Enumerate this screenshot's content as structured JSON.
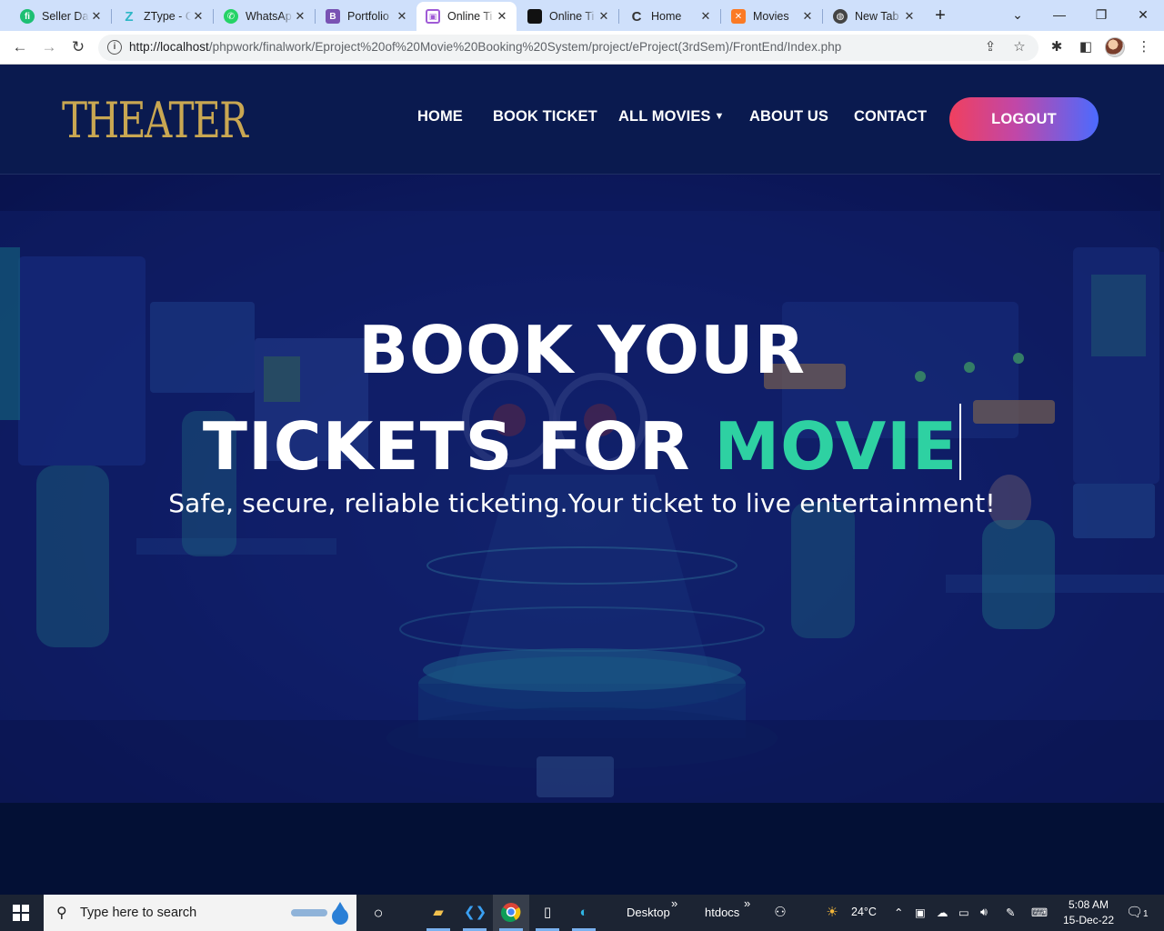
{
  "browser": {
    "tabs": [
      {
        "title": "Seller Da",
        "icon": "fiverr-icon",
        "color": "#1dbf73",
        "glyph": "fi"
      },
      {
        "title": "ZType - C",
        "icon": "ztype-icon",
        "color": "#2db7c6",
        "glyph": "Z"
      },
      {
        "title": "WhatsAp",
        "icon": "whatsapp-icon",
        "color": "#25d366",
        "glyph": "W"
      },
      {
        "title": "Portfolio",
        "icon": "bootstrap-icon",
        "color": "#7952b3",
        "glyph": "B"
      },
      {
        "title": "Online Ti",
        "icon": "site-icon",
        "color": "#a05bd6",
        "glyph": "▣",
        "active": true
      },
      {
        "title": "Online Ti",
        "icon": "site-dark-icon",
        "color": "#111111",
        "glyph": "▪"
      },
      {
        "title": "Home",
        "icon": "loading-icon",
        "color": "#444444",
        "glyph": "C"
      },
      {
        "title": "Movies",
        "icon": "xampp-icon",
        "color": "#fb7a24",
        "glyph": "✕"
      },
      {
        "title": "New Tab",
        "icon": "globe-icon",
        "color": "#444444",
        "glyph": "◍"
      }
    ],
    "url_host": "http://localhost",
    "url_path": "/phpwork/finalwork/Eproject%20of%20Movie%20Booking%20System/project/eProject(3rdSem)/FrontEnd/Index.php"
  },
  "site": {
    "logo": "THEATER",
    "nav": [
      "HOME",
      "BOOK TICKET",
      "ALL MOVIES",
      "ABOUT US",
      "CONTACT"
    ],
    "logout_label": "LOGOUT",
    "hero": {
      "line1": "BOOK YOUR",
      "line2_prefix": "TICKETS FOR",
      "line2_accent": "MOVIE",
      "subtitle": "Safe, secure, reliable ticketing.Your ticket to live entertainment!"
    },
    "colors": {
      "accent": "#2ed1a2",
      "header_bg": "#0a1a4f",
      "logo": "#c9a752"
    }
  },
  "taskbar": {
    "search_placeholder": "Type here to search",
    "folders": [
      "Desktop",
      "htdocs"
    ],
    "temperature": "24°C",
    "time": "5:08 AM",
    "date": "15-Dec-22",
    "notification_count": "1"
  }
}
